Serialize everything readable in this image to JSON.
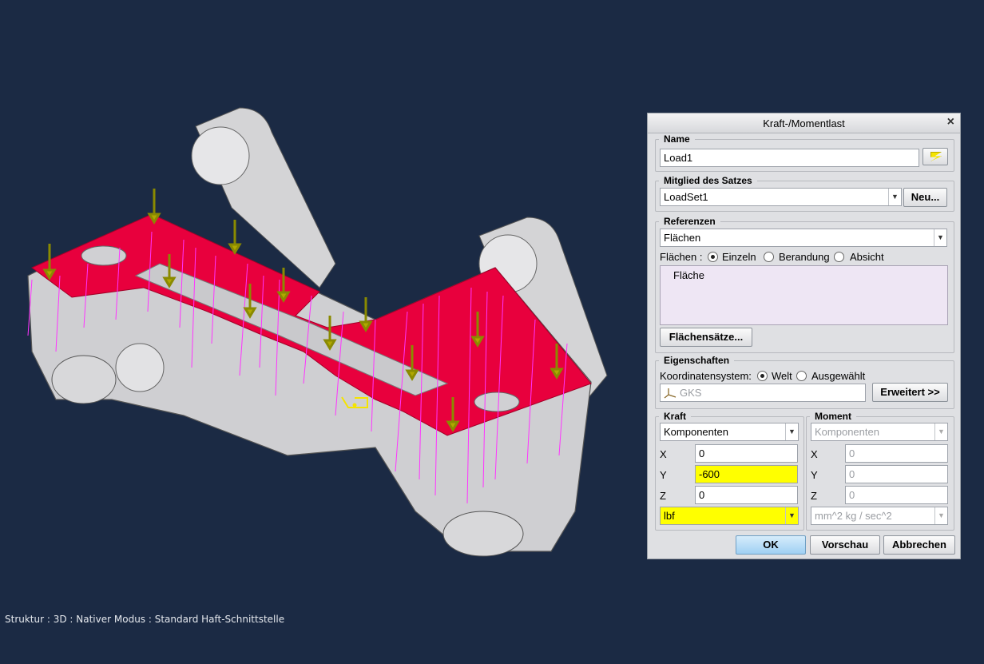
{
  "status_line": "Struktur : 3D : Nativer Modus : Standard Haft-Schnittstelle",
  "colors": {
    "background": "#1b2a44",
    "load_surface": "#e8003d",
    "force_arrows": "#ff33ff",
    "highlight_field": "#ffff00"
  },
  "dialog": {
    "title": "Kraft-/Momentlast",
    "close": "×",
    "name": {
      "legend": "Name",
      "value": "Load1",
      "icon": "lightning-icon"
    },
    "member": {
      "legend": "Mitglied des Satzes",
      "value": "LoadSet1",
      "new_button": "Neu..."
    },
    "references": {
      "legend": "Referenzen",
      "type": "Flächen",
      "mode_label": "Flächen :",
      "modes": [
        "Einzeln",
        "Berandung",
        "Absicht"
      ],
      "selected_mode": "Einzeln",
      "list_items": [
        "Fläche"
      ],
      "surface_sets_button": "Flächensätze..."
    },
    "properties": {
      "legend": "Eigenschaften",
      "cs_label": "Koordinatensystem:",
      "cs_options": [
        "Welt",
        "Ausgewählt"
      ],
      "selected_cs": "Welt",
      "cs_value": "GKS",
      "advanced_button": "Erweitert >>"
    },
    "force": {
      "legend": "Kraft",
      "type": "Komponenten",
      "x_label": "X",
      "x": "0",
      "y_label": "Y",
      "y": "-600",
      "z_label": "Z",
      "z": "0",
      "unit": "lbf"
    },
    "moment": {
      "legend": "Moment",
      "type": "Komponenten",
      "x_label": "X",
      "x": "0",
      "y_label": "Y",
      "y": "0",
      "z_label": "Z",
      "z": "0",
      "unit": "mm^2 kg / sec^2"
    },
    "buttons": {
      "ok": "OK",
      "preview": "Vorschau",
      "cancel": "Abbrechen"
    }
  }
}
